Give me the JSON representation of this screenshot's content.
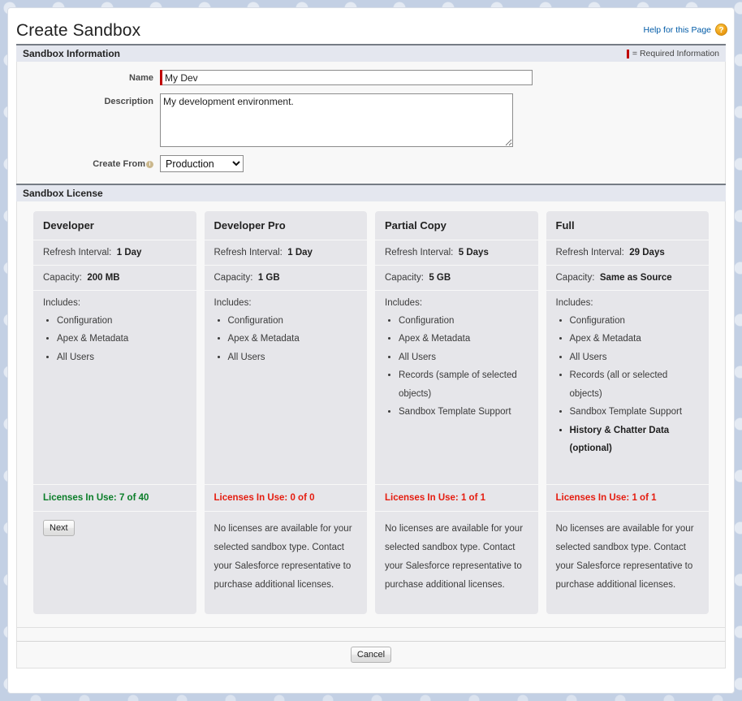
{
  "header": {
    "title": "Create Sandbox",
    "help_link": "Help for this Page",
    "help_icon": "question-mark-icon"
  },
  "sandbox_information": {
    "section_title": "Sandbox Information",
    "required_legend": "= Required Information",
    "fields": {
      "name_label": "Name",
      "name_value": "My Dev",
      "name_placeholder": "",
      "description_label": "Description",
      "description_value": "My development environment.",
      "description_placeholder": "",
      "create_from_label": "Create From",
      "create_from_value": "Production",
      "create_from_options": [
        "Production"
      ]
    }
  },
  "sandbox_license": {
    "section_title": "Sandbox License",
    "columns": [
      {
        "name": "Developer",
        "refresh_label": "Refresh Interval:",
        "refresh_value": "1 Day",
        "capacity_label": "Capacity:",
        "capacity_value": "200 MB",
        "includes_label": "Includes:",
        "includes": [
          {
            "text": "Configuration",
            "bold": false
          },
          {
            "text": "Apex & Metadata",
            "bold": false
          },
          {
            "text": "All Users",
            "bold": false
          }
        ],
        "usage": "Licenses In Use: 7 of 40",
        "usage_state": "ok",
        "action_label": "Next",
        "note": ""
      },
      {
        "name": "Developer Pro",
        "refresh_label": "Refresh Interval:",
        "refresh_value": "1 Day",
        "capacity_label": "Capacity:",
        "capacity_value": "1 GB",
        "includes_label": "Includes:",
        "includes": [
          {
            "text": "Configuration",
            "bold": false
          },
          {
            "text": "Apex & Metadata",
            "bold": false
          },
          {
            "text": "All Users",
            "bold": false
          }
        ],
        "usage": "Licenses In Use: 0 of 0",
        "usage_state": "bad",
        "action_label": "",
        "note": "No licenses are available for your selected sandbox type. Contact your Salesforce representative to purchase additional licenses."
      },
      {
        "name": "Partial Copy",
        "refresh_label": "Refresh Interval:",
        "refresh_value": "5 Days",
        "capacity_label": "Capacity:",
        "capacity_value": "5 GB",
        "includes_label": "Includes:",
        "includes": [
          {
            "text": "Configuration",
            "bold": false
          },
          {
            "text": "Apex & Metadata",
            "bold": false
          },
          {
            "text": "All Users",
            "bold": false
          },
          {
            "text": "Records (sample of selected objects)",
            "bold": false
          },
          {
            "text": "Sandbox Template Support",
            "bold": false
          }
        ],
        "usage": "Licenses In Use: 1 of 1",
        "usage_state": "bad",
        "action_label": "",
        "note": "No licenses are available for your selected sandbox type. Contact your Salesforce representative to purchase additional licenses."
      },
      {
        "name": "Full",
        "refresh_label": "Refresh Interval:",
        "refresh_value": "29 Days",
        "capacity_label": "Capacity:",
        "capacity_value": "Same as Source",
        "includes_label": "Includes:",
        "includes": [
          {
            "text": "Configuration",
            "bold": false
          },
          {
            "text": "Apex & Metadata",
            "bold": false
          },
          {
            "text": "All Users",
            "bold": false
          },
          {
            "text": "Records (all or selected objects)",
            "bold": false
          },
          {
            "text": "Sandbox Template Support",
            "bold": false
          },
          {
            "text": "History & Chatter Data (optional)",
            "bold": true
          }
        ],
        "usage": "Licenses In Use: 1 of 1",
        "usage_state": "bad",
        "action_label": "",
        "note": "No licenses are available for your selected sandbox type. Contact your Salesforce representative to purchase additional licenses."
      }
    ]
  },
  "footer": {
    "cancel_label": "Cancel"
  },
  "colors": {
    "accent_link": "#015ba7",
    "required_red": "#c00000",
    "usage_ok": "#0a7d28",
    "usage_bad": "#e51c0f",
    "section_header_bg": "#e4e7ef",
    "card_bg": "#e6e6ea"
  }
}
